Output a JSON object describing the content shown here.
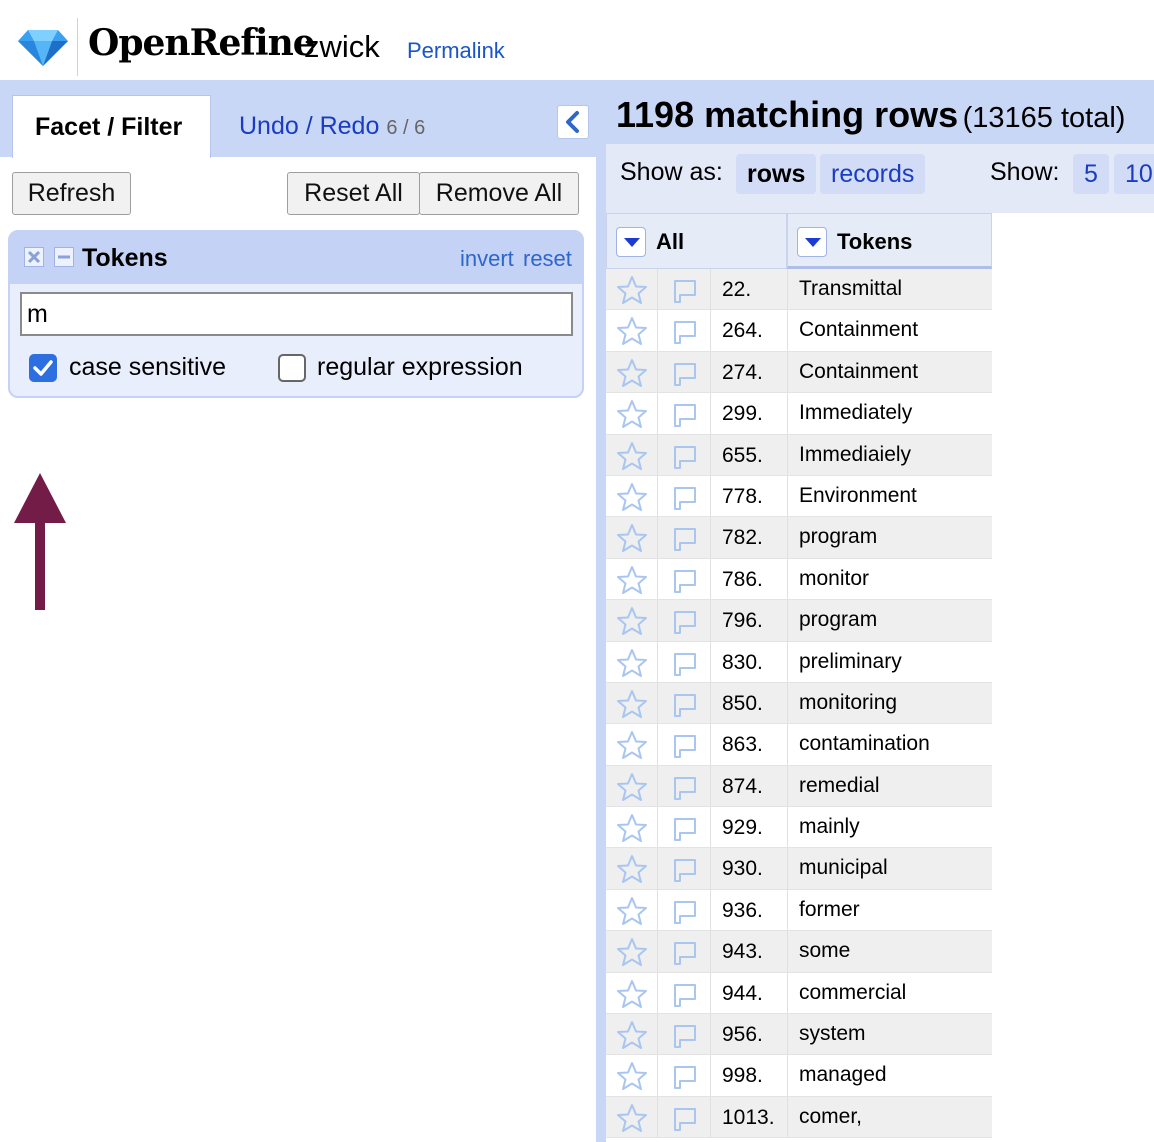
{
  "header": {
    "app_name": "OpenRefine",
    "project_name": "zwick",
    "permalink": "Permalink"
  },
  "left_panel": {
    "tabs": [
      {
        "label": "Facet / Filter"
      },
      {
        "label": "Undo / Redo",
        "count": "6 / 6"
      }
    ],
    "refresh_label": "Refresh",
    "reset_all_label": "Reset All",
    "remove_all_label": "Remove All",
    "facet": {
      "title": "Tokens",
      "invert_label": "invert",
      "reset_label": "reset",
      "query": "m",
      "case_sensitive_label": "case sensitive",
      "case_sensitive": true,
      "regex_label": "regular expression",
      "regex": false
    }
  },
  "right_panel": {
    "matching": "1198 matching rows",
    "total": "(13165 total)",
    "show_as_label": "Show as:",
    "view_rows": "rows",
    "view_records": "records",
    "show_label": "Show:",
    "page_sizes": [
      "5",
      "10"
    ],
    "columns": [
      "All",
      "Tokens"
    ],
    "rows": [
      {
        "index": "22.",
        "token": "Transmittal"
      },
      {
        "index": "264.",
        "token": "Containment"
      },
      {
        "index": "274.",
        "token": "Containment"
      },
      {
        "index": "299.",
        "token": "Immediately"
      },
      {
        "index": "655.",
        "token": "Immediaiely"
      },
      {
        "index": "778.",
        "token": "Environment"
      },
      {
        "index": "782.",
        "token": "program"
      },
      {
        "index": "786.",
        "token": "monitor"
      },
      {
        "index": "796.",
        "token": "program"
      },
      {
        "index": "830.",
        "token": "preliminary"
      },
      {
        "index": "850.",
        "token": "monitoring"
      },
      {
        "index": "863.",
        "token": "contamination"
      },
      {
        "index": "874.",
        "token": "remedial"
      },
      {
        "index": "929.",
        "token": "mainly"
      },
      {
        "index": "930.",
        "token": "municipal"
      },
      {
        "index": "936.",
        "token": "former"
      },
      {
        "index": "943.",
        "token": "some"
      },
      {
        "index": "944.",
        "token": "commercial"
      },
      {
        "index": "956.",
        "token": "system"
      },
      {
        "index": "998.",
        "token": "managed"
      },
      {
        "index": "1013.",
        "token": "comer,"
      }
    ]
  },
  "colors": {
    "panel_blue": "#c9d7f6",
    "link_blue": "#1a3cc1",
    "arrow": "#731c47"
  }
}
